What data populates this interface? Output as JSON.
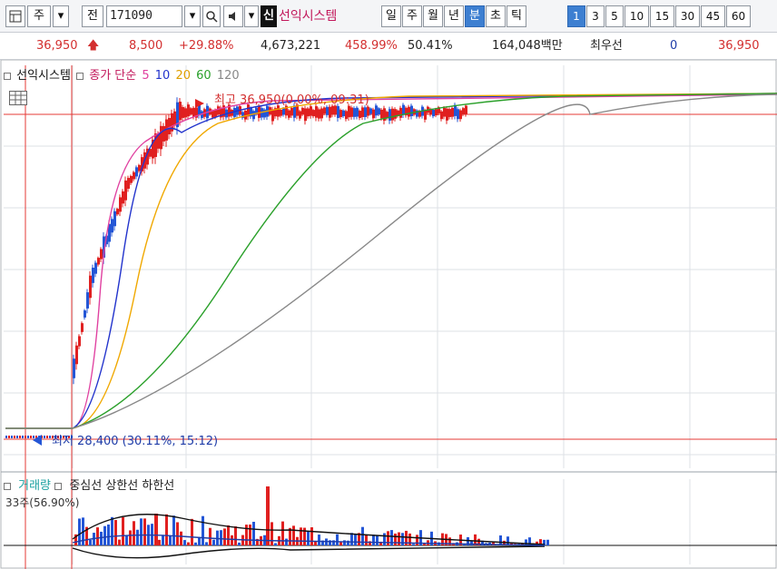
{
  "toolbar": {
    "market": "주",
    "prev_button": "전",
    "stock_code": "171090",
    "stock_name": "선익시스템",
    "name_badge": "신",
    "period_buttons": [
      "일",
      "주",
      "월",
      "년",
      "분",
      "초",
      "틱"
    ],
    "active_period": "분",
    "interval_buttons": [
      "1",
      "3",
      "5",
      "10",
      "15",
      "30",
      "45",
      "60"
    ],
    "active_interval": "1"
  },
  "price_bar": {
    "price": "36,950",
    "change": "8,500",
    "change_pct": "+29.88%",
    "volume": "4,673,221",
    "volume_ratio": "458.99%",
    "turnover": "50.41%",
    "amount": "164,048백만",
    "order_label": "최우선",
    "order_qty": "0",
    "best_price": "36,950"
  },
  "legend": {
    "title": "선익시스템",
    "ma_label": "종가 단순",
    "ma_periods": [
      "5",
      "10",
      "20",
      "60",
      "120"
    ]
  },
  "annotations": {
    "high": "최고 36,950(0.00%, 09:31)",
    "low": "최저 28,400 (30.11%, 15:12)"
  },
  "volume": {
    "legend_title": "거래량",
    "legend_items": [
      "중심선",
      "상한선",
      "하한선"
    ],
    "note": "33주(56.90%)"
  },
  "colors": {
    "up": "#e02020",
    "down": "#2456d6",
    "ma5": "#e040a0",
    "ma10": "#2233cc",
    "ma20": "#f0a800",
    "ma60": "#2aa02a",
    "ma120": "#888888",
    "accent": "#3d7fd1"
  },
  "chart_data": {
    "type": "candlestick",
    "symbol": "171090",
    "price_range": [
      28400,
      36950
    ],
    "high": 36950,
    "low": 28400,
    "moving_averages": [
      "5",
      "10",
      "20",
      "60",
      "120"
    ]
  }
}
